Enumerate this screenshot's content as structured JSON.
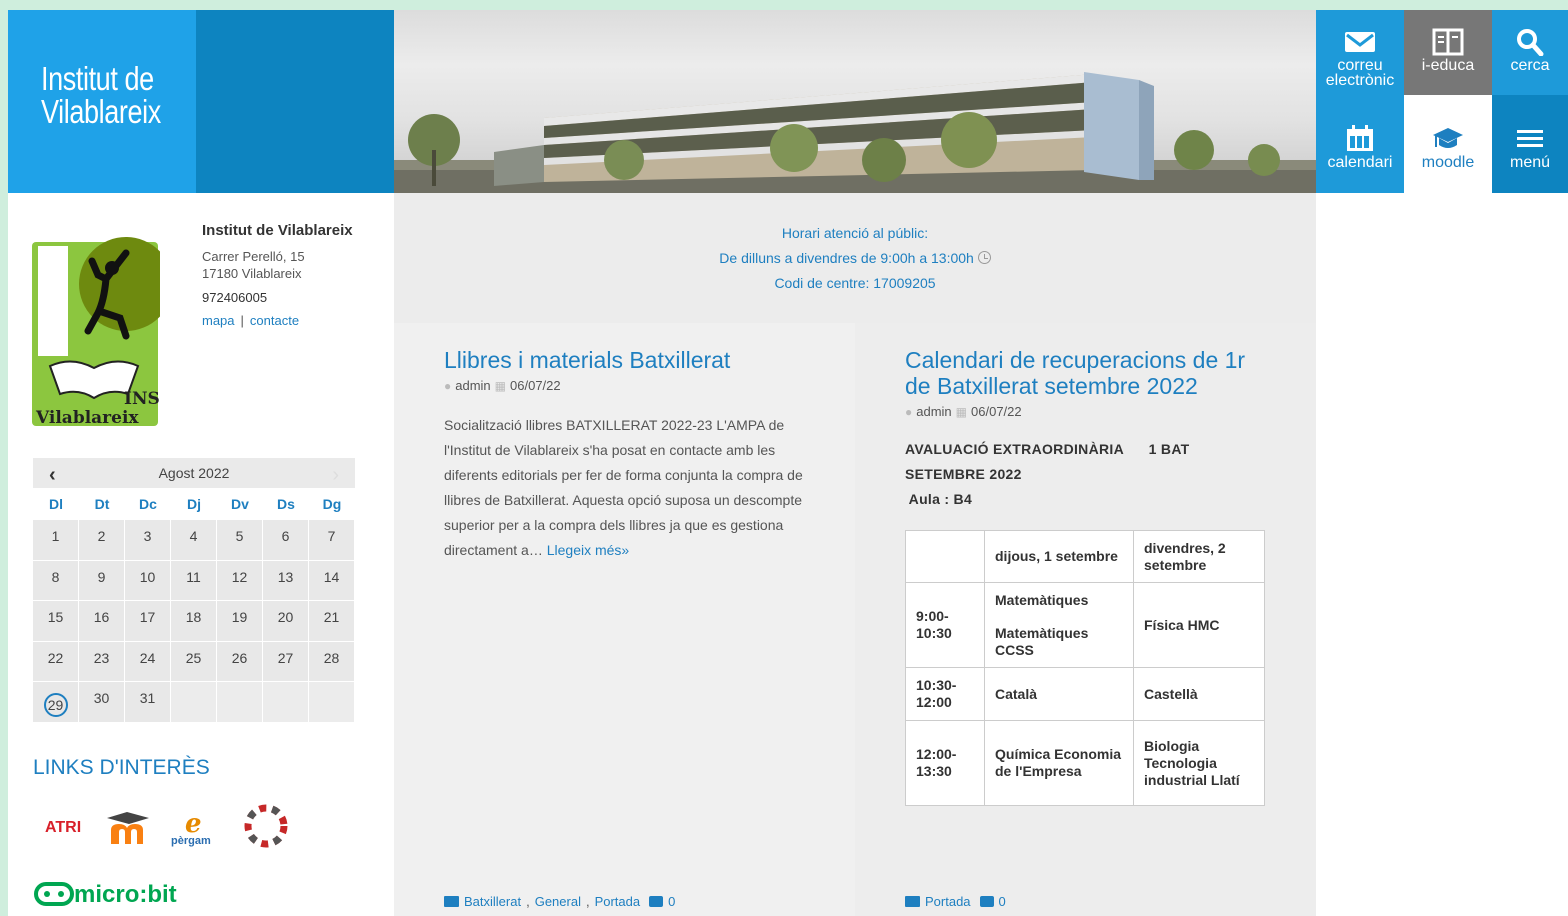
{
  "header": {
    "site_title_line1": "Institut de",
    "site_title_line2": "Vilablareix"
  },
  "tiles": {
    "correu_line1": "correu",
    "correu_line2": "electrònic",
    "ieduca": "i-educa",
    "cerca": "cerca",
    "calendari": "calendari",
    "moodle": "moodle",
    "menu": "menú"
  },
  "logo": {
    "line1": "INS",
    "line2": "Vilablareix"
  },
  "contact": {
    "name": "Institut de Vilablareix",
    "address_line1": "Carrer Perelló, 15",
    "address_line2": "17180 Vilablareix",
    "phone": "972406005",
    "map_link": "mapa",
    "separator": "|",
    "contact_link": "contacte"
  },
  "calendar": {
    "month": "Agost 2022",
    "prev": "‹",
    "next": "›",
    "weekdays": [
      "Dl",
      "Dt",
      "Dc",
      "Dj",
      "Dv",
      "Ds",
      "Dg"
    ],
    "weeks": [
      [
        "1",
        "2",
        "3",
        "4",
        "5",
        "6",
        "7"
      ],
      [
        "8",
        "9",
        "10",
        "11",
        "12",
        "13",
        "14"
      ],
      [
        "15",
        "16",
        "17",
        "18",
        "19",
        "20",
        "21"
      ],
      [
        "22",
        "23",
        "24",
        "25",
        "26",
        "27",
        "28"
      ],
      [
        "29",
        "30",
        "31",
        "",
        "",
        "",
        ""
      ]
    ],
    "today": "29"
  },
  "links": {
    "title": "LINKS D'INTERÈS",
    "atri": "ATRI",
    "pergam_e": "e",
    "pergam": "pèrgam",
    "microbit": "micro:bit"
  },
  "info": {
    "line1": "Horari atenció al públic:",
    "line2": "De dilluns a divendres de 9:00h a 13:00h",
    "line3": "Codi de centre: 17009205"
  },
  "post1": {
    "title": "Llibres i materials Batxillerat",
    "author": "admin",
    "date": "06/07/22",
    "excerpt": "Socialització llibres BATXILLERAT 2022-23 L'AMPA de l'Institut de Vilablareix s'ha posat en contacte amb les diferents editorials per fer de forma conjunta la compra de llibres de Batxillerat. Aquesta opció suposa un descompte superior per a la compra dels llibres ja que es gestiona directament a…",
    "read_more": "Llegeix més»",
    "cat1": "Batxillerat",
    "cat2": "General",
    "cat3": "Portada",
    "comments": "0"
  },
  "post2": {
    "title": "Calendari de recuperacions de 1r de Batxillerat setembre 2022",
    "author": "admin",
    "date": "06/07/22",
    "heading1": "AVALUACIÓ EXTRAORDINÀRIA      1 BAT",
    "heading2": "SETEMBRE 2022",
    "heading3": " Aula : B4",
    "table": {
      "h1": "dijous, 1 setembre",
      "h2": "divendres, 2 setembre",
      "r1_time": "9:00-10:30",
      "r1_c1a": "Matemàtiques",
      "r1_c1b": "Matemàtiques CCSS",
      "r1_c2": "Física HMC",
      "r2_time": "10:30-12:00",
      "r2_c1": "Català",
      "r2_c2": "Castellà",
      "r3_time": "12:00-13:30",
      "r3_c1": "Química Economia de l'Empresa",
      "r3_c2": "Biologia Tecnologia industrial Llatí"
    },
    "cat1": "Portada",
    "comments": "0"
  },
  "colors": {
    "brand_blue": "#1fa2e8",
    "dark_blue": "#0d84c0",
    "link_blue": "#1e7fc0",
    "grey_tile": "#777777",
    "logo_green": "#8cc63f"
  }
}
